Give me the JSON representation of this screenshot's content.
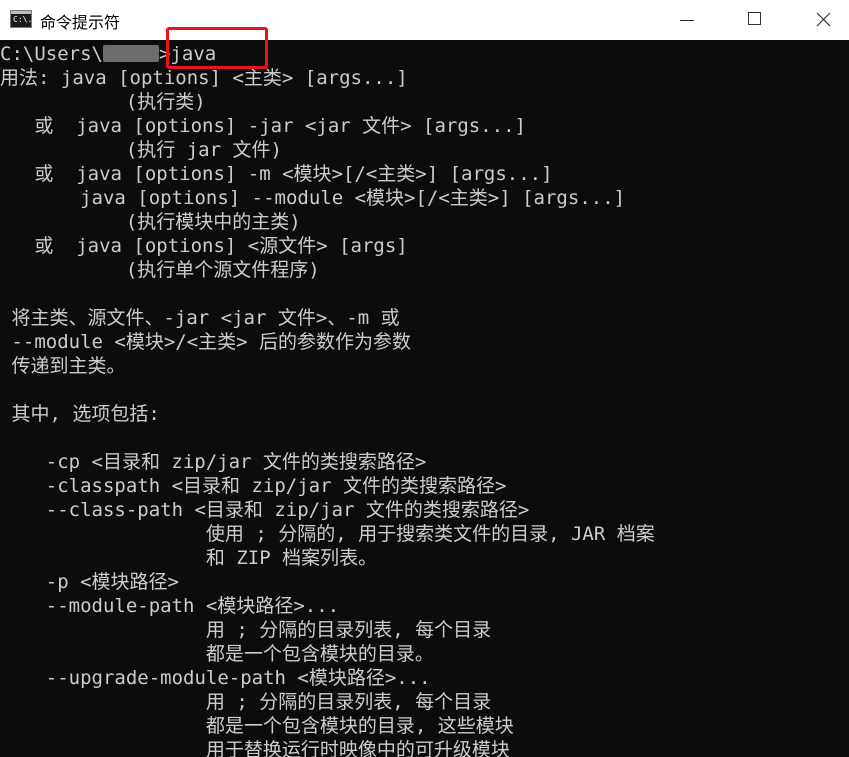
{
  "window": {
    "title": "命令提示符",
    "icon": "cmd-icon",
    "icon_glyph": "C:\\.",
    "controls": [
      "minimize-icon",
      "maximize-icon",
      "close-icon"
    ]
  },
  "console": {
    "prompt_prefix": "C:\\Users\\",
    "prompt_suffix": ">",
    "command": "java",
    "lines": [
      "用法: java [options] <主类> [args...]",
      "           (执行类)",
      "   或  java [options] -jar <jar 文件> [args...]",
      "           (执行 jar 文件)",
      "   或  java [options] -m <模块>[/<主类>] [args...]",
      "       java [options] --module <模块>[/<主类>] [args...]",
      "           (执行模块中的主类)",
      "   或  java [options] <源文件> [args]",
      "           (执行单个源文件程序)",
      "",
      " 将主类、源文件、-jar <jar 文件>、-m 或",
      " --module <模块>/<主类> 后的参数作为参数",
      " 传递到主类。",
      "",
      " 其中, 选项包括:",
      "",
      "    -cp <目录和 zip/jar 文件的类搜索路径>",
      "    -classpath <目录和 zip/jar 文件的类搜索路径>",
      "    --class-path <目录和 zip/jar 文件的类搜索路径>",
      "                  使用 ; 分隔的, 用于搜索类文件的目录, JAR 档案",
      "                  和 ZIP 档案列表。",
      "    -p <模块路径>",
      "    --module-path <模块路径>...",
      "                  用 ; 分隔的目录列表, 每个目录",
      "                  都是一个包含模块的目录。",
      "    --upgrade-module-path <模块路径>...",
      "                  用 ; 分隔的目录列表, 每个目录",
      "                  都是一个包含模块的目录, 这些模块",
      "                  用于替换运行时映像中的可升级模块"
    ]
  },
  "colors": {
    "background": "#0c0c0c",
    "text": "#cccccc",
    "highlight": "#e8141c"
  }
}
